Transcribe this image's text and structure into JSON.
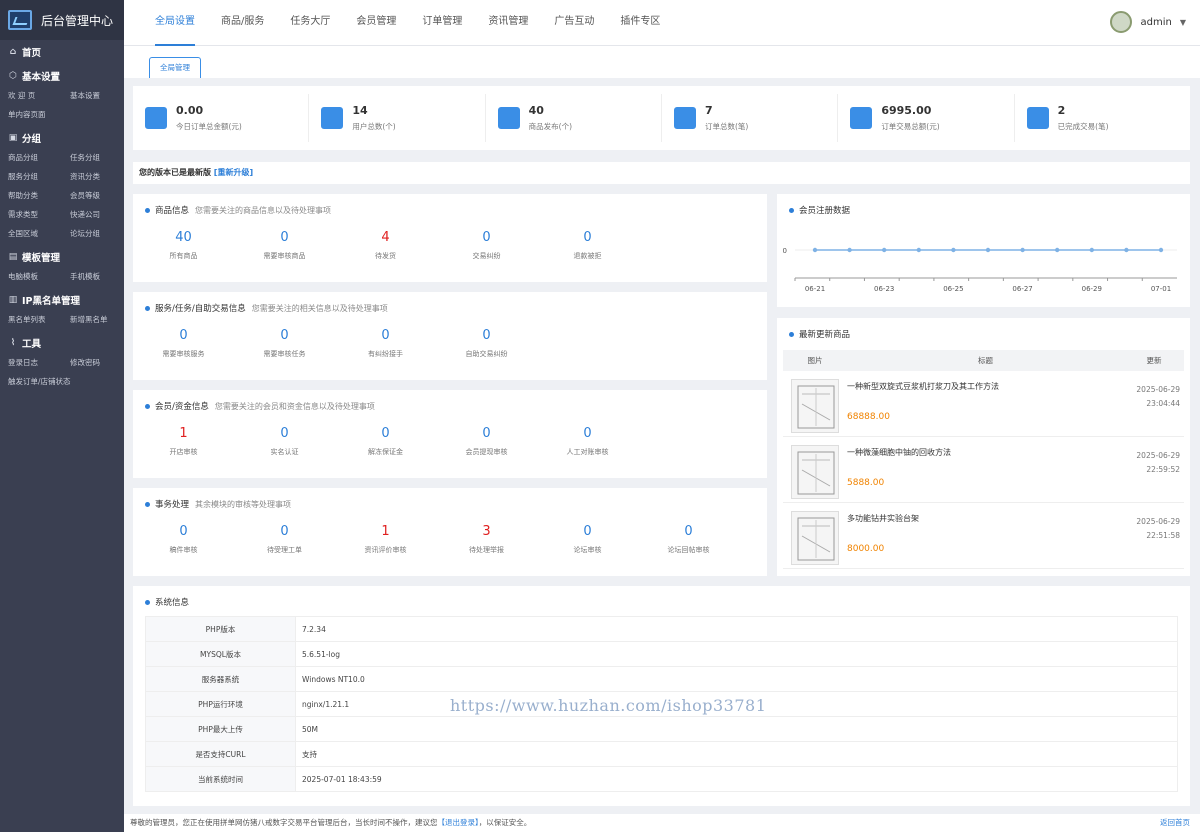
{
  "app_title": "后台管理中心",
  "sidebar": {
    "home": "首页",
    "sections": [
      {
        "title": "基本设置",
        "icon": "cube-icon",
        "items": [
          "欢 迎 页",
          "基本设置",
          "单内容页面"
        ]
      },
      {
        "title": "分组",
        "icon": "briefcase-icon",
        "items": [
          "商品分组",
          "任务分组",
          "服务分组",
          "资讯分类",
          "帮助分类",
          "会员等级",
          "需求类型",
          "快递公司",
          "全国区域",
          "论坛分组"
        ]
      },
      {
        "title": "模板管理",
        "icon": "template-icon",
        "items": [
          "电脑模板",
          "手机模板"
        ]
      },
      {
        "title": "IP黑名单管理",
        "icon": "ip-icon",
        "items": [
          "黑名单列表",
          "新增黑名单"
        ]
      },
      {
        "title": "工具",
        "icon": "chart-line-icon",
        "items": [
          "登录日志",
          "修改密码",
          "触发订单/店铺状态"
        ]
      }
    ]
  },
  "topnav": [
    "全局设置",
    "商品/服务",
    "任务大厅",
    "会员管理",
    "订单管理",
    "资讯管理",
    "广告互动",
    "插件专区"
  ],
  "user": {
    "name": "admin"
  },
  "subtab": "全局管理",
  "stats": [
    {
      "value": "0.00",
      "label": "今日订单总金额(元)",
      "icon": "pen-square-icon"
    },
    {
      "value": "14",
      "label": "用户总数(个)",
      "icon": "users-icon"
    },
    {
      "value": "40",
      "label": "商品发布(个)",
      "icon": "bag-icon"
    },
    {
      "value": "7",
      "label": "订单总数(笔)",
      "icon": "layers-icon"
    },
    {
      "value": "6995.00",
      "label": "订单交易总额(元)",
      "icon": "bars-icon"
    },
    {
      "value": "2",
      "label": "已完成交易(笔)",
      "icon": "trash-like-icon"
    }
  ],
  "version": {
    "text": "您的版本已是最新版",
    "link": "[重新升级]"
  },
  "infoboxes": [
    {
      "title": "商品信息",
      "sub": "您需要关注的商品信息以及待处理事项",
      "items": [
        {
          "v": "40",
          "l": "所有商品",
          "red": false
        },
        {
          "v": "0",
          "l": "需要审核商品",
          "red": false
        },
        {
          "v": "4",
          "l": "待发货",
          "red": true
        },
        {
          "v": "0",
          "l": "交易纠纷",
          "red": false
        },
        {
          "v": "0",
          "l": "退款被拒",
          "red": false
        }
      ]
    },
    {
      "title": "服务/任务/自助交易信息",
      "sub": "您需要关注的相关信息以及待处理事项",
      "items": [
        {
          "v": "0",
          "l": "需要审核服务",
          "red": false
        },
        {
          "v": "0",
          "l": "需要审核任务",
          "red": false
        },
        {
          "v": "0",
          "l": "有纠纷接手",
          "red": false
        },
        {
          "v": "0",
          "l": "自助交易纠纷",
          "red": false
        }
      ]
    },
    {
      "title": "会员/资金信息",
      "sub": "您需要关注的会员和资金信息以及待处理事项",
      "items": [
        {
          "v": "1",
          "l": "开店审核",
          "red": true
        },
        {
          "v": "0",
          "l": "实名认证",
          "red": false
        },
        {
          "v": "0",
          "l": "解冻保证金",
          "red": false
        },
        {
          "v": "0",
          "l": "会员提现审核",
          "red": false
        },
        {
          "v": "0",
          "l": "人工对账审核",
          "red": false
        }
      ]
    },
    {
      "title": "事务处理",
      "sub": "其余模块的审核等处理事项",
      "items": [
        {
          "v": "0",
          "l": "稿件审核",
          "red": false
        },
        {
          "v": "0",
          "l": "待受理工单",
          "red": false
        },
        {
          "v": "1",
          "l": "资讯评价审核",
          "red": true
        },
        {
          "v": "3",
          "l": "待处理举报",
          "red": true
        },
        {
          "v": "0",
          "l": "论坛审核",
          "red": false
        },
        {
          "v": "0",
          "l": "论坛回帖审核",
          "red": false
        }
      ]
    }
  ],
  "chart_data": {
    "type": "line",
    "title": "会员注册数据",
    "x": [
      "06-21",
      "06-22",
      "06-23",
      "06-24",
      "06-25",
      "06-26",
      "06-27",
      "06-28",
      "06-29",
      "06-30",
      "07-01"
    ],
    "x_tick_labels": [
      "06-21",
      "06-23",
      "06-25",
      "06-27",
      "06-29",
      "07-01"
    ],
    "y_tick": "0",
    "series": [
      {
        "values": [
          0,
          0,
          0,
          0,
          0,
          0,
          0,
          0,
          0,
          0,
          0
        ]
      }
    ],
    "line_color": "#7fb2e5"
  },
  "newest": {
    "title": "最新更新商品",
    "headers": [
      "图片",
      "标题",
      "更新"
    ],
    "rows": [
      {
        "title": "一种新型双旋式豆浆机打浆刀及其工作方法",
        "price": "68888.00",
        "date": "2025-06-29",
        "time": "23:04:44"
      },
      {
        "title": "一种微藻细胞中铀的回收方法",
        "price": "5888.00",
        "date": "2025-06-29",
        "time": "22:59:52"
      },
      {
        "title": "多功能钻井实验台架",
        "price": "8000.00",
        "date": "2025-06-29",
        "time": "22:51:58"
      }
    ]
  },
  "system": {
    "title": "系统信息",
    "rows": [
      {
        "k": "PHP版本",
        "v": "7.2.34"
      },
      {
        "k": "MYSQL版本",
        "v": "5.6.51-log"
      },
      {
        "k": "服务器系统",
        "v": "Windows NT10.0"
      },
      {
        "k": "PHP运行环境",
        "v": "nginx/1.21.1"
      },
      {
        "k": "PHP最大上传",
        "v": "50M"
      },
      {
        "k": "是否支持CURL",
        "v": "支持"
      },
      {
        "k": "当前系统时间",
        "v": "2025-07-01 18:43:59"
      }
    ]
  },
  "footer": {
    "text": "尊敬的管理员，您正在使用拼单网仿猪八戒数字交易平台管理后台，当长时间不操作，建议您",
    "link": "【退出登录】",
    "tail": "，以保证安全。",
    "back": "返回首页"
  },
  "watermark": "https://www.huzhan.com/ishop33781"
}
